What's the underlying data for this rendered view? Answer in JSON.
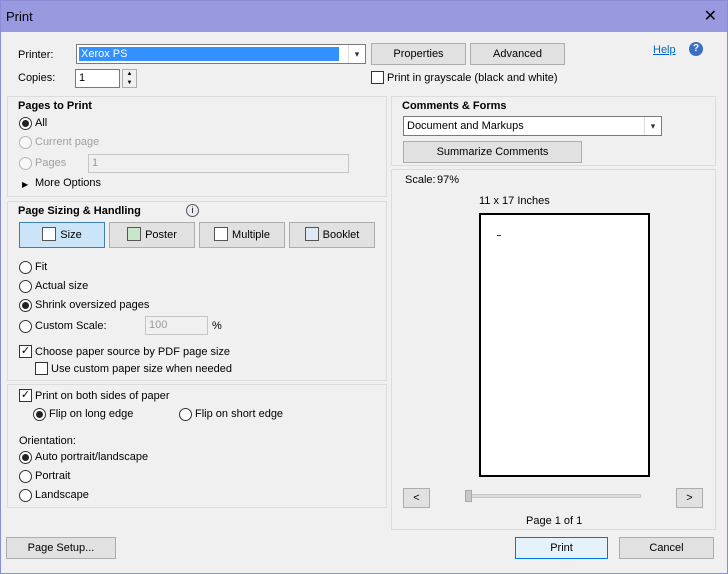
{
  "window": {
    "title": "Print",
    "close_glyph": "✕"
  },
  "top": {
    "printer_label": "Printer:",
    "printer_value": "Xerox PS",
    "properties_label": "Properties",
    "advanced_label": "Advanced",
    "help_label": "Help",
    "copies_label": "Copies:",
    "copies_value": "1",
    "grayscale_label": "Print in grayscale (black and white)"
  },
  "pages_to_print": {
    "heading": "Pages to Print",
    "all_label": "All",
    "current_page_label": "Current page",
    "pages_label": "Pages",
    "pages_value": "1",
    "more_options_label": "More Options"
  },
  "sizing": {
    "heading": "Page Sizing & Handling",
    "size_btn": "Size",
    "poster_btn": "Poster",
    "multiple_btn": "Multiple",
    "booklet_btn": "Booklet",
    "fit_label": "Fit",
    "actual_size_label": "Actual size",
    "shrink_label": "Shrink oversized pages",
    "custom_scale_label": "Custom Scale:",
    "custom_scale_value": "100",
    "percent": "%",
    "choose_source_label": "Choose paper source by PDF page size",
    "custom_paper_label": "Use custom paper size when needed"
  },
  "duplex": {
    "both_sides_label": "Print on both sides of paper",
    "long_edge_label": "Flip on long edge",
    "short_edge_label": "Flip on short edge",
    "orientation_label": "Orientation:",
    "auto_label": "Auto portrait/landscape",
    "portrait_label": "Portrait",
    "landscape_label": "Landscape"
  },
  "comments": {
    "heading": "Comments & Forms",
    "select_value": "Document and Markups",
    "summarize_label": "Summarize Comments"
  },
  "preview": {
    "scale_label": "Scale:",
    "scale_value": "97%",
    "paper_size": "11 x 17 Inches",
    "prev_glyph": "<",
    "next_glyph": ">",
    "page_indicator": "Page 1 of 1"
  },
  "footer": {
    "page_setup_label": "Page Setup...",
    "print_label": "Print",
    "cancel_label": "Cancel"
  },
  "icons": {
    "help": "?",
    "info": "i",
    "dropdown": "▾",
    "triangle": "▶",
    "spin_up": "▲",
    "spin_down": "▼"
  }
}
